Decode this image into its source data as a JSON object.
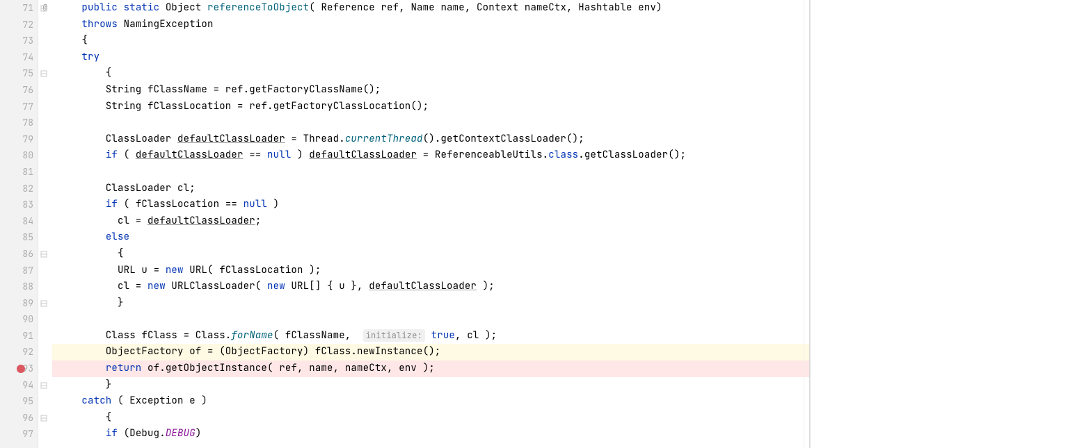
{
  "lineStart": 71,
  "lineCount": 27,
  "gutterMarkers": {
    "71": "@"
  },
  "foldMarkers": [
    71,
    75,
    86,
    89,
    94,
    96
  ],
  "breakpointLine": 93,
  "highlights": {
    "92": "yellow",
    "93": "pink"
  },
  "hint_initialize": "initialize:",
  "code": {
    "71": [
      [
        "    "
      ],
      [
        "kw",
        "public"
      ],
      [
        " "
      ],
      [
        "kw",
        "static"
      ],
      [
        " Object "
      ],
      [
        "meth",
        "referenceToObject"
      ],
      [
        "( Reference ref, Name name, Context nameCtx, Hashtable env)"
      ]
    ],
    "72": [
      [
        "    "
      ],
      [
        "kw",
        "throws"
      ],
      [
        " NamingException"
      ]
    ],
    "73": [
      [
        "    {"
      ]
    ],
    "74": [
      [
        "    "
      ],
      [
        "kw",
        "try"
      ]
    ],
    "75": [
      [
        "        {"
      ]
    ],
    "76": [
      [
        "        String fClassName = ref.getFactoryClassName();"
      ]
    ],
    "77": [
      [
        "        String fClassLocation = ref.getFactoryClassLocation();"
      ]
    ],
    "78": [
      [
        ""
      ]
    ],
    "79": [
      [
        "        ClassLoader "
      ],
      [
        "underline",
        "defaultClassLoader"
      ],
      [
        " = Thread."
      ],
      [
        "mstat",
        "currentThread"
      ],
      [
        "().getContextClassLoader();"
      ]
    ],
    "80": [
      [
        "        "
      ],
      [
        "kw",
        "if"
      ],
      [
        " ( "
      ],
      [
        "underline",
        "defaultClassLoader"
      ],
      [
        " == "
      ],
      [
        "kw",
        "null"
      ],
      [
        " ) "
      ],
      [
        "underline",
        "defaultClassLoader"
      ],
      [
        " = ReferenceableUtils."
      ],
      [
        "kw",
        "class"
      ],
      [
        ".getClassLoader();"
      ]
    ],
    "81": [
      [
        ""
      ]
    ],
    "82": [
      [
        "        ClassLoader cl;"
      ]
    ],
    "83": [
      [
        "        "
      ],
      [
        "kw",
        "if"
      ],
      [
        " ( fClassLocation == "
      ],
      [
        "kw",
        "null"
      ],
      [
        " )"
      ]
    ],
    "84": [
      [
        "          cl = "
      ],
      [
        "underline",
        "defaultClassLoader"
      ],
      [
        ";"
      ]
    ],
    "85": [
      [
        "        "
      ],
      [
        "kw",
        "else"
      ]
    ],
    "86": [
      [
        "          {"
      ]
    ],
    "87": [
      [
        "          URL u = "
      ],
      [
        "kw",
        "new"
      ],
      [
        " URL( fClassLocation );"
      ]
    ],
    "88": [
      [
        "          cl = "
      ],
      [
        "kw",
        "new"
      ],
      [
        " URLClassLoader( "
      ],
      [
        "kw",
        "new"
      ],
      [
        " URL[] { u }, "
      ],
      [
        "underline",
        "defaultClassLoader"
      ],
      [
        " );"
      ]
    ],
    "89": [
      [
        "          }"
      ]
    ],
    "90": [
      [
        ""
      ]
    ],
    "91": [
      [
        "        Class fClass = Class."
      ],
      [
        "mstat",
        "forName"
      ],
      [
        "( fClassName,  "
      ],
      [
        "hint",
        "@hint_initialize"
      ],
      [
        " "
      ],
      [
        "kw",
        "true"
      ],
      [
        ", cl );"
      ]
    ],
    "92": [
      [
        "        ObjectFactory of = (ObjectFactory) fClass.newInstance();"
      ]
    ],
    "93": [
      [
        "        "
      ],
      [
        "kw",
        "return"
      ],
      [
        " of.getObjectInstance( ref, name, nameCtx, env );"
      ]
    ],
    "94": [
      [
        "        }"
      ]
    ],
    "95": [
      [
        "    "
      ],
      [
        "kw",
        "catch"
      ],
      [
        " ( Exception e )"
      ]
    ],
    "96": [
      [
        "        {"
      ]
    ],
    "97": [
      [
        "        "
      ],
      [
        "kw",
        "if"
      ],
      [
        " (Debug."
      ],
      [
        "field",
        "DEBUG"
      ],
      [
        ")"
      ]
    ]
  }
}
